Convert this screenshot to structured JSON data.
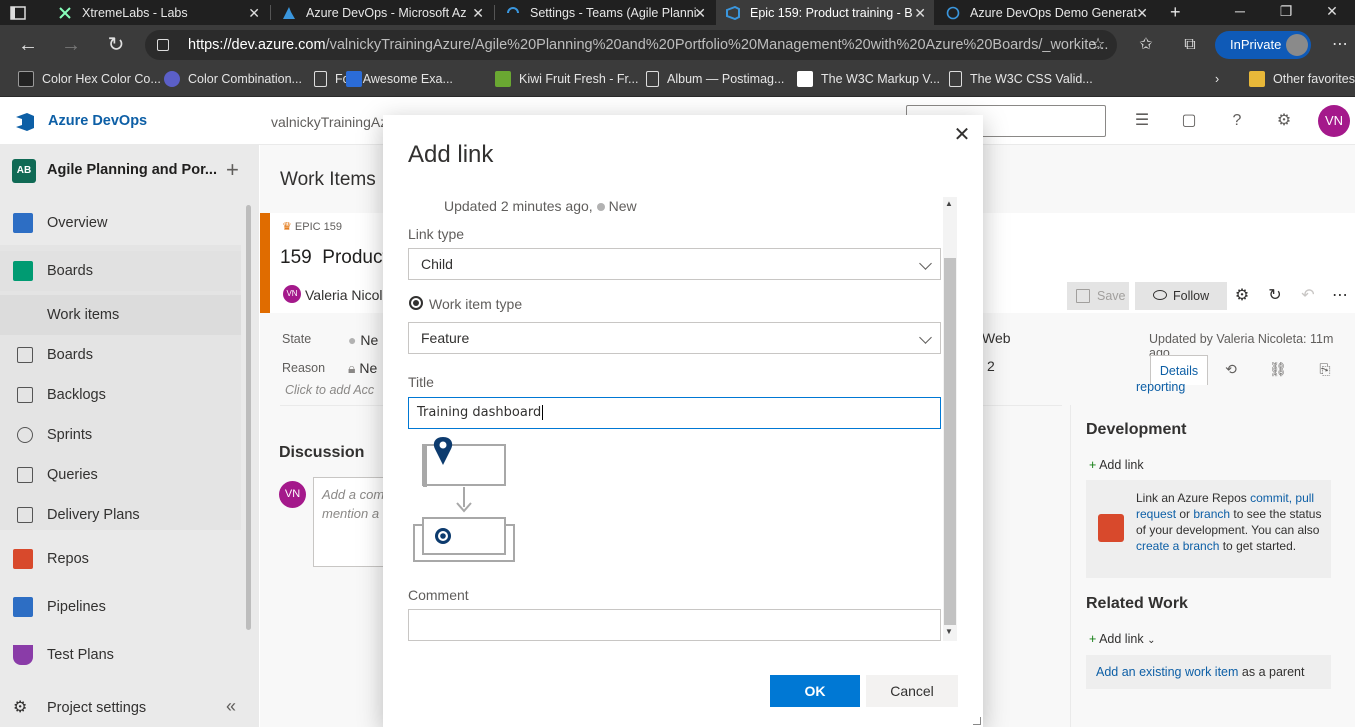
{
  "browser": {
    "tabs": [
      {
        "label": "XtremeLabs - Labs",
        "active": false
      },
      {
        "label": "Azure DevOps - Microsoft Az",
        "active": false
      },
      {
        "label": "Settings - Teams (Agile Planni",
        "active": false
      },
      {
        "label": "Epic 159: Product training - B",
        "active": true
      },
      {
        "label": "Azure DevOps Demo Generat",
        "active": false
      }
    ],
    "url_host": "https://dev.azure.com",
    "url_path": "/valnickyTrainingAzure/Agile%20Planning%20and%20Portfolio%20Management%20with%20Azure%20Boards/_workite...",
    "inprivate_label": "InPrivate",
    "favorites": [
      "Color Hex Color Co...",
      "Color Combination...",
      "Font Awesome Exa...",
      "Kiwi Fruit Fresh - Fr...",
      "Album — Postimag...",
      "The W3C Markup V...",
      "The W3C CSS Valid..."
    ],
    "other_favorites": "Other favorites"
  },
  "ado": {
    "brand": "Azure DevOps",
    "org": "valnickyTrainingAz",
    "user_initials": "VN"
  },
  "nav": {
    "project_badge": "AB",
    "project_name": "Agile Planning and Por...",
    "items": [
      {
        "label": "Overview"
      },
      {
        "label": "Boards"
      },
      {
        "label": "Work items"
      },
      {
        "label": "Boards"
      },
      {
        "label": "Backlogs"
      },
      {
        "label": "Sprints"
      },
      {
        "label": "Queries"
      },
      {
        "label": "Delivery Plans"
      },
      {
        "label": "Repos"
      },
      {
        "label": "Pipelines"
      },
      {
        "label": "Test Plans"
      }
    ],
    "project_settings": "Project settings"
  },
  "workitem": {
    "page_title": "Work Items",
    "epic_tag": "EPIC 159",
    "epic_number": "159",
    "epic_title_partial": "Product",
    "assignee": "Valeria Nicol",
    "assignee_initials": "VN",
    "state_label": "State",
    "state_value": "Ne",
    "reason_label": "Reason",
    "reason_value": "Ne",
    "acceptance_placeholder": "Click to add Acc",
    "discussion_label": "Discussion",
    "discussion_placeholder": "Add a com mention a",
    "save_label": "Save",
    "follow_label": "Follow",
    "updated_by": "Updated by Valeria Nicoleta: 11m ago",
    "web_text": "Web",
    "two_text": "2",
    "details_tab": "Details",
    "report_link": "reporting",
    "development_header": "Development",
    "dev_add_link": "Add link",
    "dev_text_1": "Link an Azure Repos ",
    "dev_link_commit": "commit,",
    "dev_link_pr": "pull request",
    "dev_text_or": " or ",
    "dev_link_branch": "branch",
    "dev_text_2": " to see the status of your development. You can also ",
    "dev_link_create": "create a branch",
    "dev_text_3": " to get started.",
    "related_header": "Related Work",
    "rel_add_link": "Add link",
    "rel_existing": "Add an existing work item",
    "rel_as_parent": " as a parent"
  },
  "dialog": {
    "title": "Add link",
    "updated": "Updated 2 minutes ago,",
    "status": "New",
    "link_type_label": "Link type",
    "link_type_value": "Child",
    "work_item_type_label": "Work item type",
    "work_item_type_value": "Feature",
    "title_label": "Title",
    "title_value": "Training dashboard",
    "comment_label": "Comment",
    "comment_value": "",
    "ok_label": "OK",
    "cancel_label": "Cancel"
  },
  "colors": {
    "accent": "#0078d4",
    "brand_blue": "#0d5fa6",
    "epic_orange": "#e06c00",
    "avatar_magenta": "#a4198b"
  }
}
